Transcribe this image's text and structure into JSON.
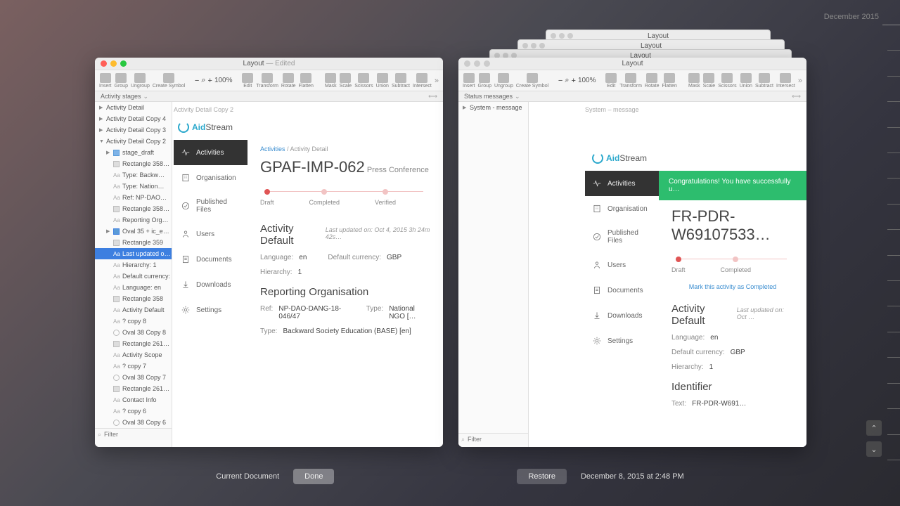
{
  "date_corner": "December 2015",
  "stacked": [
    "Layout",
    "Layout",
    "Layout"
  ],
  "windows": {
    "left": {
      "title": "Layout",
      "edited": "— Edited",
      "subbar": "Activity stages",
      "zoom": "100%",
      "artboard_label": "Activity Detail Copy 2",
      "layers": [
        {
          "label": "Activity Detail",
          "cls": "",
          "ico": "tri-closed"
        },
        {
          "label": "Activity Detail Copy 4",
          "cls": "",
          "ico": "tri-closed"
        },
        {
          "label": "Activity Detail Copy 3",
          "cls": "",
          "ico": "tri-closed"
        },
        {
          "label": "Activity Detail Copy 2",
          "cls": "",
          "ico": "tri-open"
        },
        {
          "label": "stage_draft",
          "cls": "indent1",
          "ico": "folder"
        },
        {
          "label": "Rectangle 358…",
          "cls": "indent2",
          "ico": "sq"
        },
        {
          "label": "Type:   Backw…",
          "cls": "indent2",
          "ico": "tx"
        },
        {
          "label": "Type:   Nation…",
          "cls": "indent2",
          "ico": "tx"
        },
        {
          "label": "Ref:   NP-DAO…",
          "cls": "indent2",
          "ico": "tx"
        },
        {
          "label": "Rectangle 358…",
          "cls": "indent2",
          "ico": "sq"
        },
        {
          "label": "Reporting Org…",
          "cls": "indent2",
          "ico": "tx"
        },
        {
          "label": "Oval 35 + ic_e…",
          "cls": "indent1",
          "ico": "folder-sel"
        },
        {
          "label": "Rectangle 359",
          "cls": "indent2",
          "ico": "sq"
        },
        {
          "label": "Last updated o…",
          "cls": "indent2 selected",
          "ico": "tx"
        },
        {
          "label": "Hierarchy:   1",
          "cls": "indent2",
          "ico": "tx"
        },
        {
          "label": "Default currency:",
          "cls": "indent2",
          "ico": "tx"
        },
        {
          "label": "Language:   en",
          "cls": "indent2",
          "ico": "tx"
        },
        {
          "label": "Rectangle 358",
          "cls": "indent2",
          "ico": "sq"
        },
        {
          "label": "Activity Default",
          "cls": "indent2",
          "ico": "tx"
        },
        {
          "label": "? copy 8",
          "cls": "indent2",
          "ico": "tx"
        },
        {
          "label": "Oval 38 Copy 8",
          "cls": "indent2",
          "ico": "circ"
        },
        {
          "label": "Rectangle 261…",
          "cls": "indent2",
          "ico": "sq"
        },
        {
          "label": "Activity Scope",
          "cls": "indent2",
          "ico": "tx"
        },
        {
          "label": "? copy 7",
          "cls": "indent2",
          "ico": "tx"
        },
        {
          "label": "Oval 38 Copy 7",
          "cls": "indent2",
          "ico": "circ"
        },
        {
          "label": "Rectangle 261…",
          "cls": "indent2",
          "ico": "sq"
        },
        {
          "label": "Contact Info",
          "cls": "indent2",
          "ico": "tx"
        },
        {
          "label": "? copy 6",
          "cls": "indent2",
          "ico": "tx"
        },
        {
          "label": "Oval 38 Copy 6",
          "cls": "indent2",
          "ico": "circ"
        }
      ]
    },
    "right": {
      "title": "Layout",
      "subbar": "Status messages",
      "zoom": "100%",
      "artboard_label": "System – message",
      "layers": [
        {
          "label": "System - message",
          "cls": "",
          "ico": "tri-closed"
        }
      ]
    }
  },
  "toolbar": [
    "Insert",
    "Group",
    "Ungroup",
    "Create Symbol",
    "",
    "Edit",
    "Transform",
    "Rotate",
    "Flatten",
    "",
    "Mask",
    "Scale",
    "Scissors",
    "Union",
    "Subtract",
    "Intersect"
  ],
  "filter_placeholder": "Filter",
  "brand": {
    "a": "Aid",
    "b": "Stream"
  },
  "sidenav": [
    {
      "label": "Activities",
      "active": true
    },
    {
      "label": "Organisation"
    },
    {
      "label": "Published Files"
    },
    {
      "label": "Users"
    },
    {
      "label": "Documents"
    },
    {
      "label": "Downloads"
    },
    {
      "label": "Settings"
    }
  ],
  "left_content": {
    "breadcrumb_link": "Activities",
    "breadcrumb_tail": " / Activity Detail",
    "title": "GPAF-IMP-062",
    "subtitle": "Press Conference",
    "stages": [
      "Draft",
      "Completed",
      "Verified"
    ],
    "section_def": "Activity Default",
    "def_sub": "Last updated on:  Oct 4, 2015 3h 24m 42s…",
    "kv1": [
      {
        "k": "Language:",
        "v": "en"
      },
      {
        "k": "Default currency:",
        "v": "GBP"
      }
    ],
    "kv2": [
      {
        "k": "Hierarchy:",
        "v": "1"
      }
    ],
    "section_rep": "Reporting Organisation",
    "kv3": [
      {
        "k": "Ref:",
        "v": "NP-DAO-DANG-18-046/47"
      },
      {
        "k": "Type:",
        "v": "National NGO […"
      }
    ],
    "kv4": [
      {
        "k": "Type:",
        "v": "Backward Society Education (BASE) [en]"
      }
    ]
  },
  "right_content": {
    "success": "Congratulations! You have successfully u…",
    "title": "FR-PDR-W69107533…",
    "stages": [
      "Draft",
      "Completed"
    ],
    "mark_link": "Mark this activity as Completed",
    "section_def": "Activity Default",
    "def_sub": "Last updated on:  Oct …",
    "kv1": [
      {
        "k": "Language:",
        "v": "en"
      }
    ],
    "kv2": [
      {
        "k": "Default currency:",
        "v": "GBP"
      }
    ],
    "kv3": [
      {
        "k": "Hierarchy:",
        "v": "1"
      }
    ],
    "section_id": "Identifier",
    "kv4": [
      {
        "k": "Text:",
        "v": "FR-PDR-W691…"
      }
    ]
  },
  "bottom": {
    "left_label": "Current Document",
    "done": "Done",
    "restore": "Restore",
    "right_label": "December 8, 2015 at 2:48 PM"
  }
}
